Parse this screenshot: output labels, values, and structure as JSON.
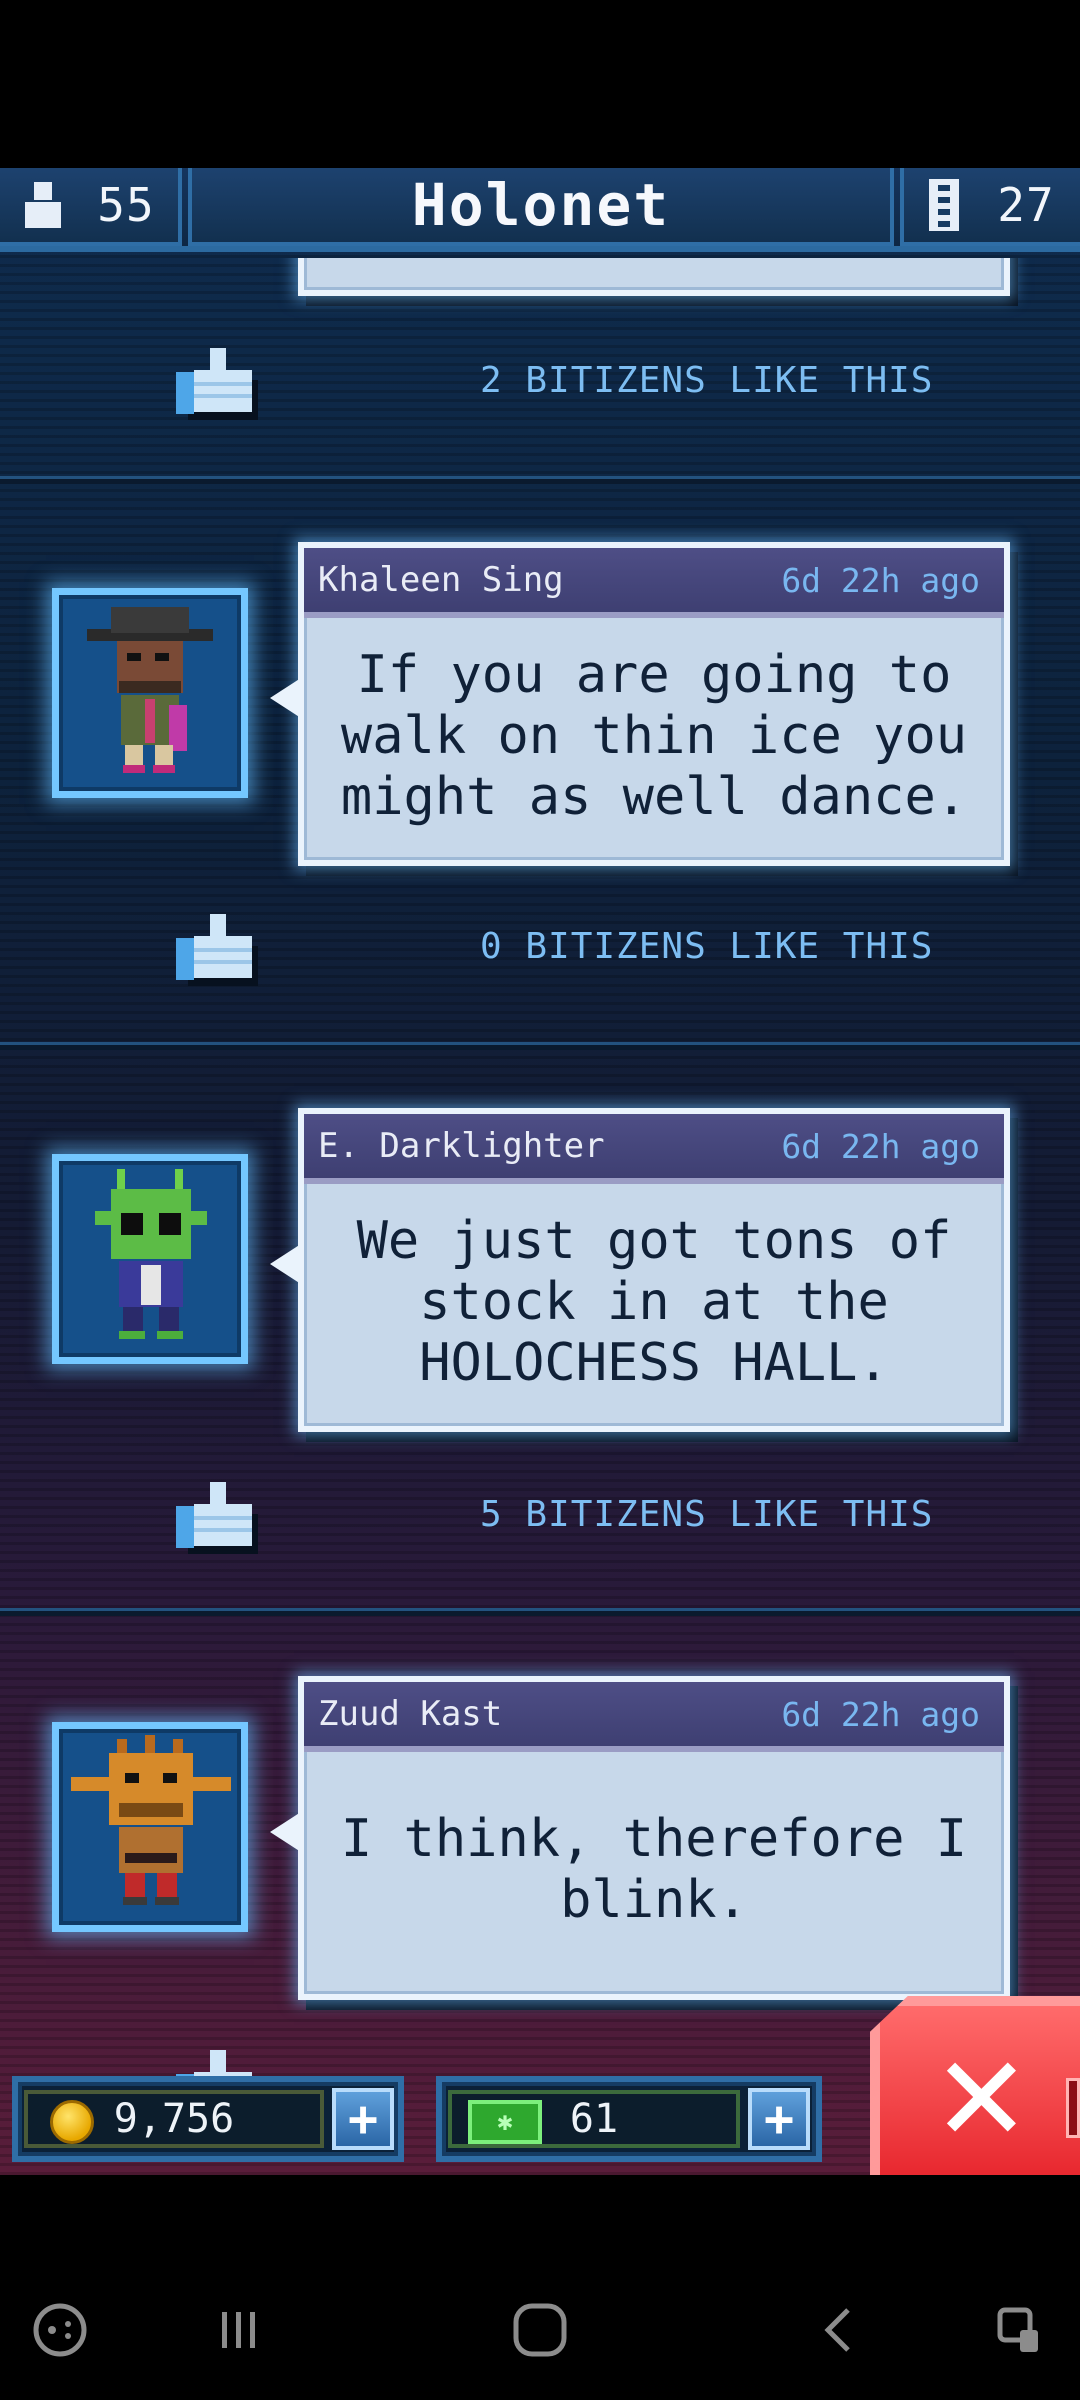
{
  "header": {
    "population": "55",
    "title": "Holonet",
    "floors": "27"
  },
  "posts": [
    {
      "likes_text": "2 BITIZENS LIKE THIS"
    },
    {
      "name": "Khaleen Sing",
      "time": "6d 22h ago",
      "message": "If you are going to walk on thin ice you might as well dance.",
      "likes_text": "0 BITIZENS LIKE THIS"
    },
    {
      "name": "E. Darklighter",
      "time": "6d 22h ago",
      "message": "We just got tons of stock in at the HOLOCHESS HALL.",
      "likes_text": "5 BITIZENS LIKE THIS"
    },
    {
      "name": "Zuud Kast",
      "time": "6d 22h ago",
      "message": "I think, therefore I blink."
    }
  ],
  "hud": {
    "coins": "9,756",
    "bux": "61"
  },
  "icons": {
    "population": "person-icon",
    "floors": "building-icon",
    "like": "thumbs-up-icon",
    "coin": "coin-icon",
    "bux": "bux-icon",
    "close": "close-icon"
  },
  "colors": {
    "accent": "#74c7ff",
    "bubble": "#c7d8ea",
    "bubble_header": "#45457a",
    "like_text": "#7dbdf2",
    "close": "#e8282f"
  }
}
